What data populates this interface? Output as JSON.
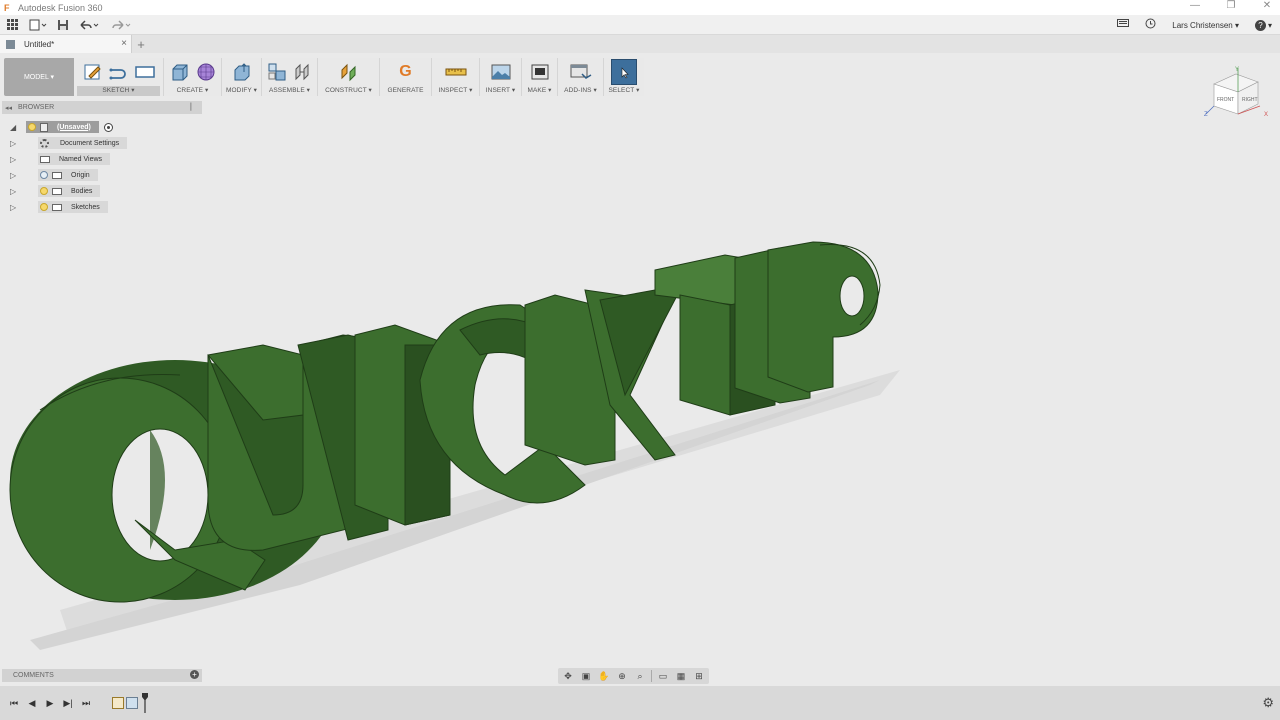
{
  "app": {
    "title": "Autodesk Fusion 360",
    "logo_letter": "F",
    "window_controls": [
      "—",
      "❐",
      "✕"
    ]
  },
  "quick_access": {
    "grid_icon": "grid-icon",
    "file_icon": "file-icon",
    "save_icon": "save-icon",
    "undo_icon": "undo-icon",
    "redo_icon": "redo-icon",
    "job_status_icon": "job-status-icon",
    "history_icon": "clock-icon",
    "user_name": "Lars Christensen",
    "help_label": "?"
  },
  "tabs": [
    {
      "label": "Untitled*",
      "close": "×"
    }
  ],
  "new_tab_label": "+",
  "ribbon": {
    "workspace": "MODEL ▾",
    "groups": [
      {
        "label": "SKETCH ▾"
      },
      {
        "label": "CREATE ▾"
      },
      {
        "label": "MODIFY ▾"
      },
      {
        "label": "ASSEMBLE ▾"
      },
      {
        "label": "CONSTRUCT ▾"
      },
      {
        "label": "GENERATE"
      },
      {
        "label": "INSPECT ▾"
      },
      {
        "label": "INSERT ▾"
      },
      {
        "label": "MAKE ▾"
      },
      {
        "label": "ADD-INS ▾"
      },
      {
        "label": "SELECT ▾"
      }
    ],
    "generate_letter": "G"
  },
  "browser": {
    "title": "BROWSER",
    "root": "(Unsaved)",
    "items": [
      {
        "label": "Document Settings",
        "icon": "gear-icon"
      },
      {
        "label": "Named Views",
        "icon": "folder-icon"
      },
      {
        "label": "Origin",
        "icon": "folder-icon"
      },
      {
        "label": "Bodies",
        "icon": "folder-icon"
      },
      {
        "label": "Sketches",
        "icon": "folder-icon"
      }
    ]
  },
  "comments": {
    "title": "COMMENTS",
    "add": "+"
  },
  "viewcube": {
    "front": "FRONT",
    "right": "RIGHT",
    "axis_x": "X",
    "axis_y": "Y",
    "axis_z": "Z"
  },
  "model_text": "QUICKTIP",
  "colors": {
    "model_green": "#3c6e2e",
    "model_dark": "#254d1c",
    "accent_blue": "#3d6f9c"
  },
  "navbar": {
    "icons": [
      "orbit-icon",
      "look-at-icon",
      "pan-icon",
      "zoom-icon",
      "fit-icon",
      "display-settings-icon",
      "grid-settings-icon",
      "viewports-icon"
    ]
  },
  "timeline": {
    "buttons": [
      "⏮",
      "◀",
      "▶",
      "▶|",
      "⏭"
    ],
    "settings": "⚙"
  }
}
